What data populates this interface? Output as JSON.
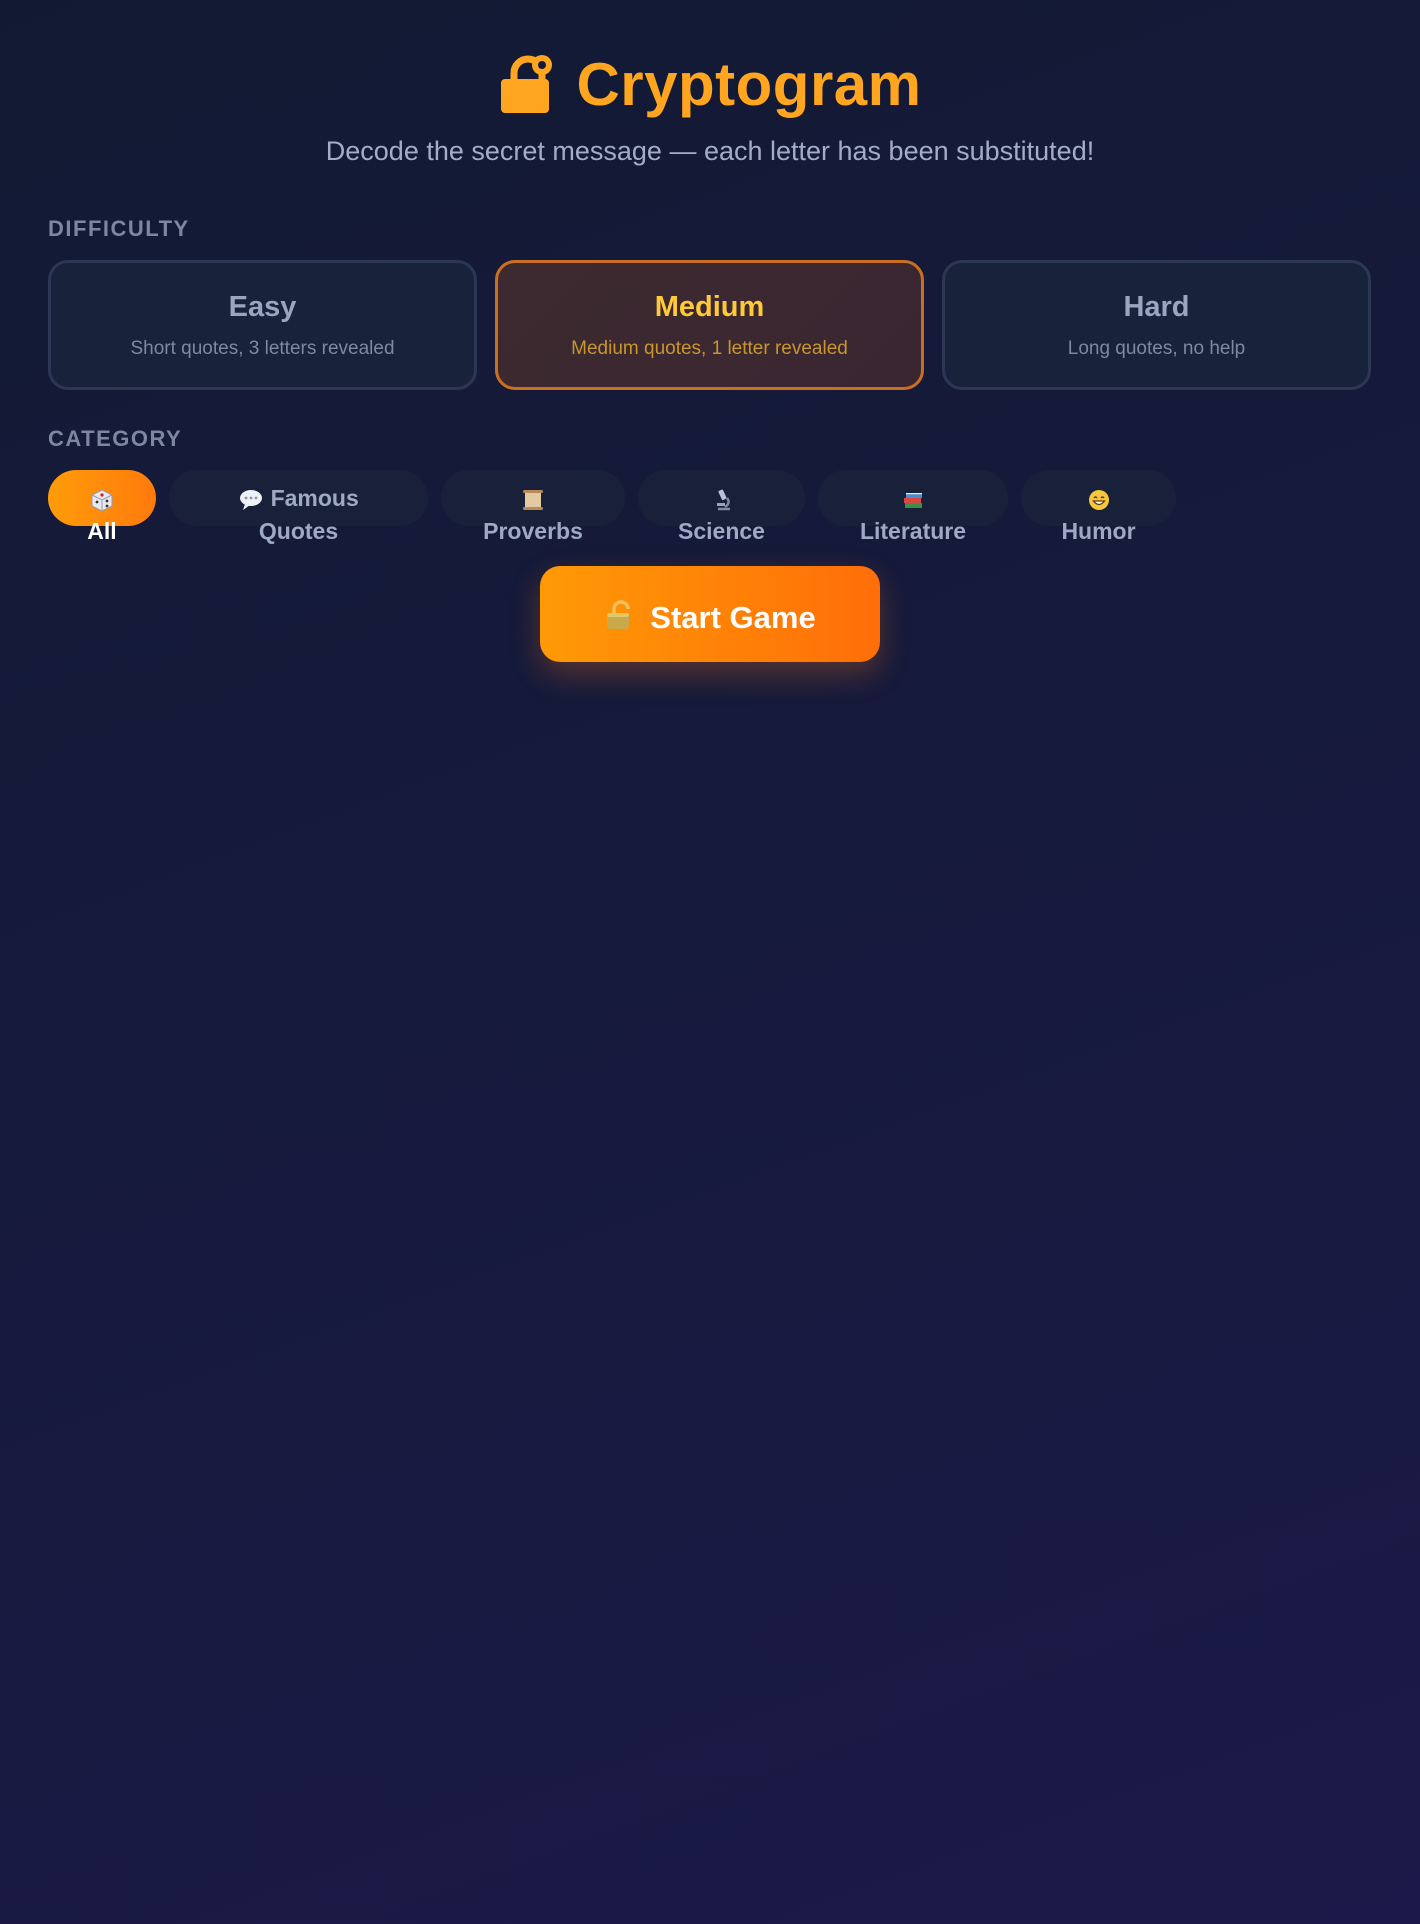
{
  "header": {
    "title": "Cryptogram",
    "title_icon": "lock-icon",
    "subtitle": "Decode the secret message — each letter has been substituted!"
  },
  "difficulty": {
    "label": "DIFFICULTY",
    "selected": "Medium",
    "options": [
      {
        "name": "Easy",
        "desc": "Short quotes, 3 letters revealed"
      },
      {
        "name": "Medium",
        "desc": "Medium quotes, 1 letter revealed"
      },
      {
        "name": "Hard",
        "desc": "Long quotes, no help"
      }
    ]
  },
  "category": {
    "label": "CATEGORY",
    "selected": "All",
    "options": [
      {
        "name": "All",
        "icon": "dice-icon"
      },
      {
        "name": "Famous Quotes",
        "icon": "speech-bubble-icon"
      },
      {
        "name": "Proverbs",
        "icon": "scroll-icon"
      },
      {
        "name": "Science",
        "icon": "microscope-icon"
      },
      {
        "name": "Literature",
        "icon": "books-icon"
      },
      {
        "name": "Humor",
        "icon": "grinning-face-icon"
      }
    ]
  },
  "start": {
    "label": "Start Game",
    "icon": "unlock-icon"
  },
  "colors": {
    "accent": "#ffa51f",
    "accent_gradient_end": "#ff6e08",
    "background": "#151a3a",
    "card": "#19223b",
    "active_text": "#ffc93a"
  }
}
